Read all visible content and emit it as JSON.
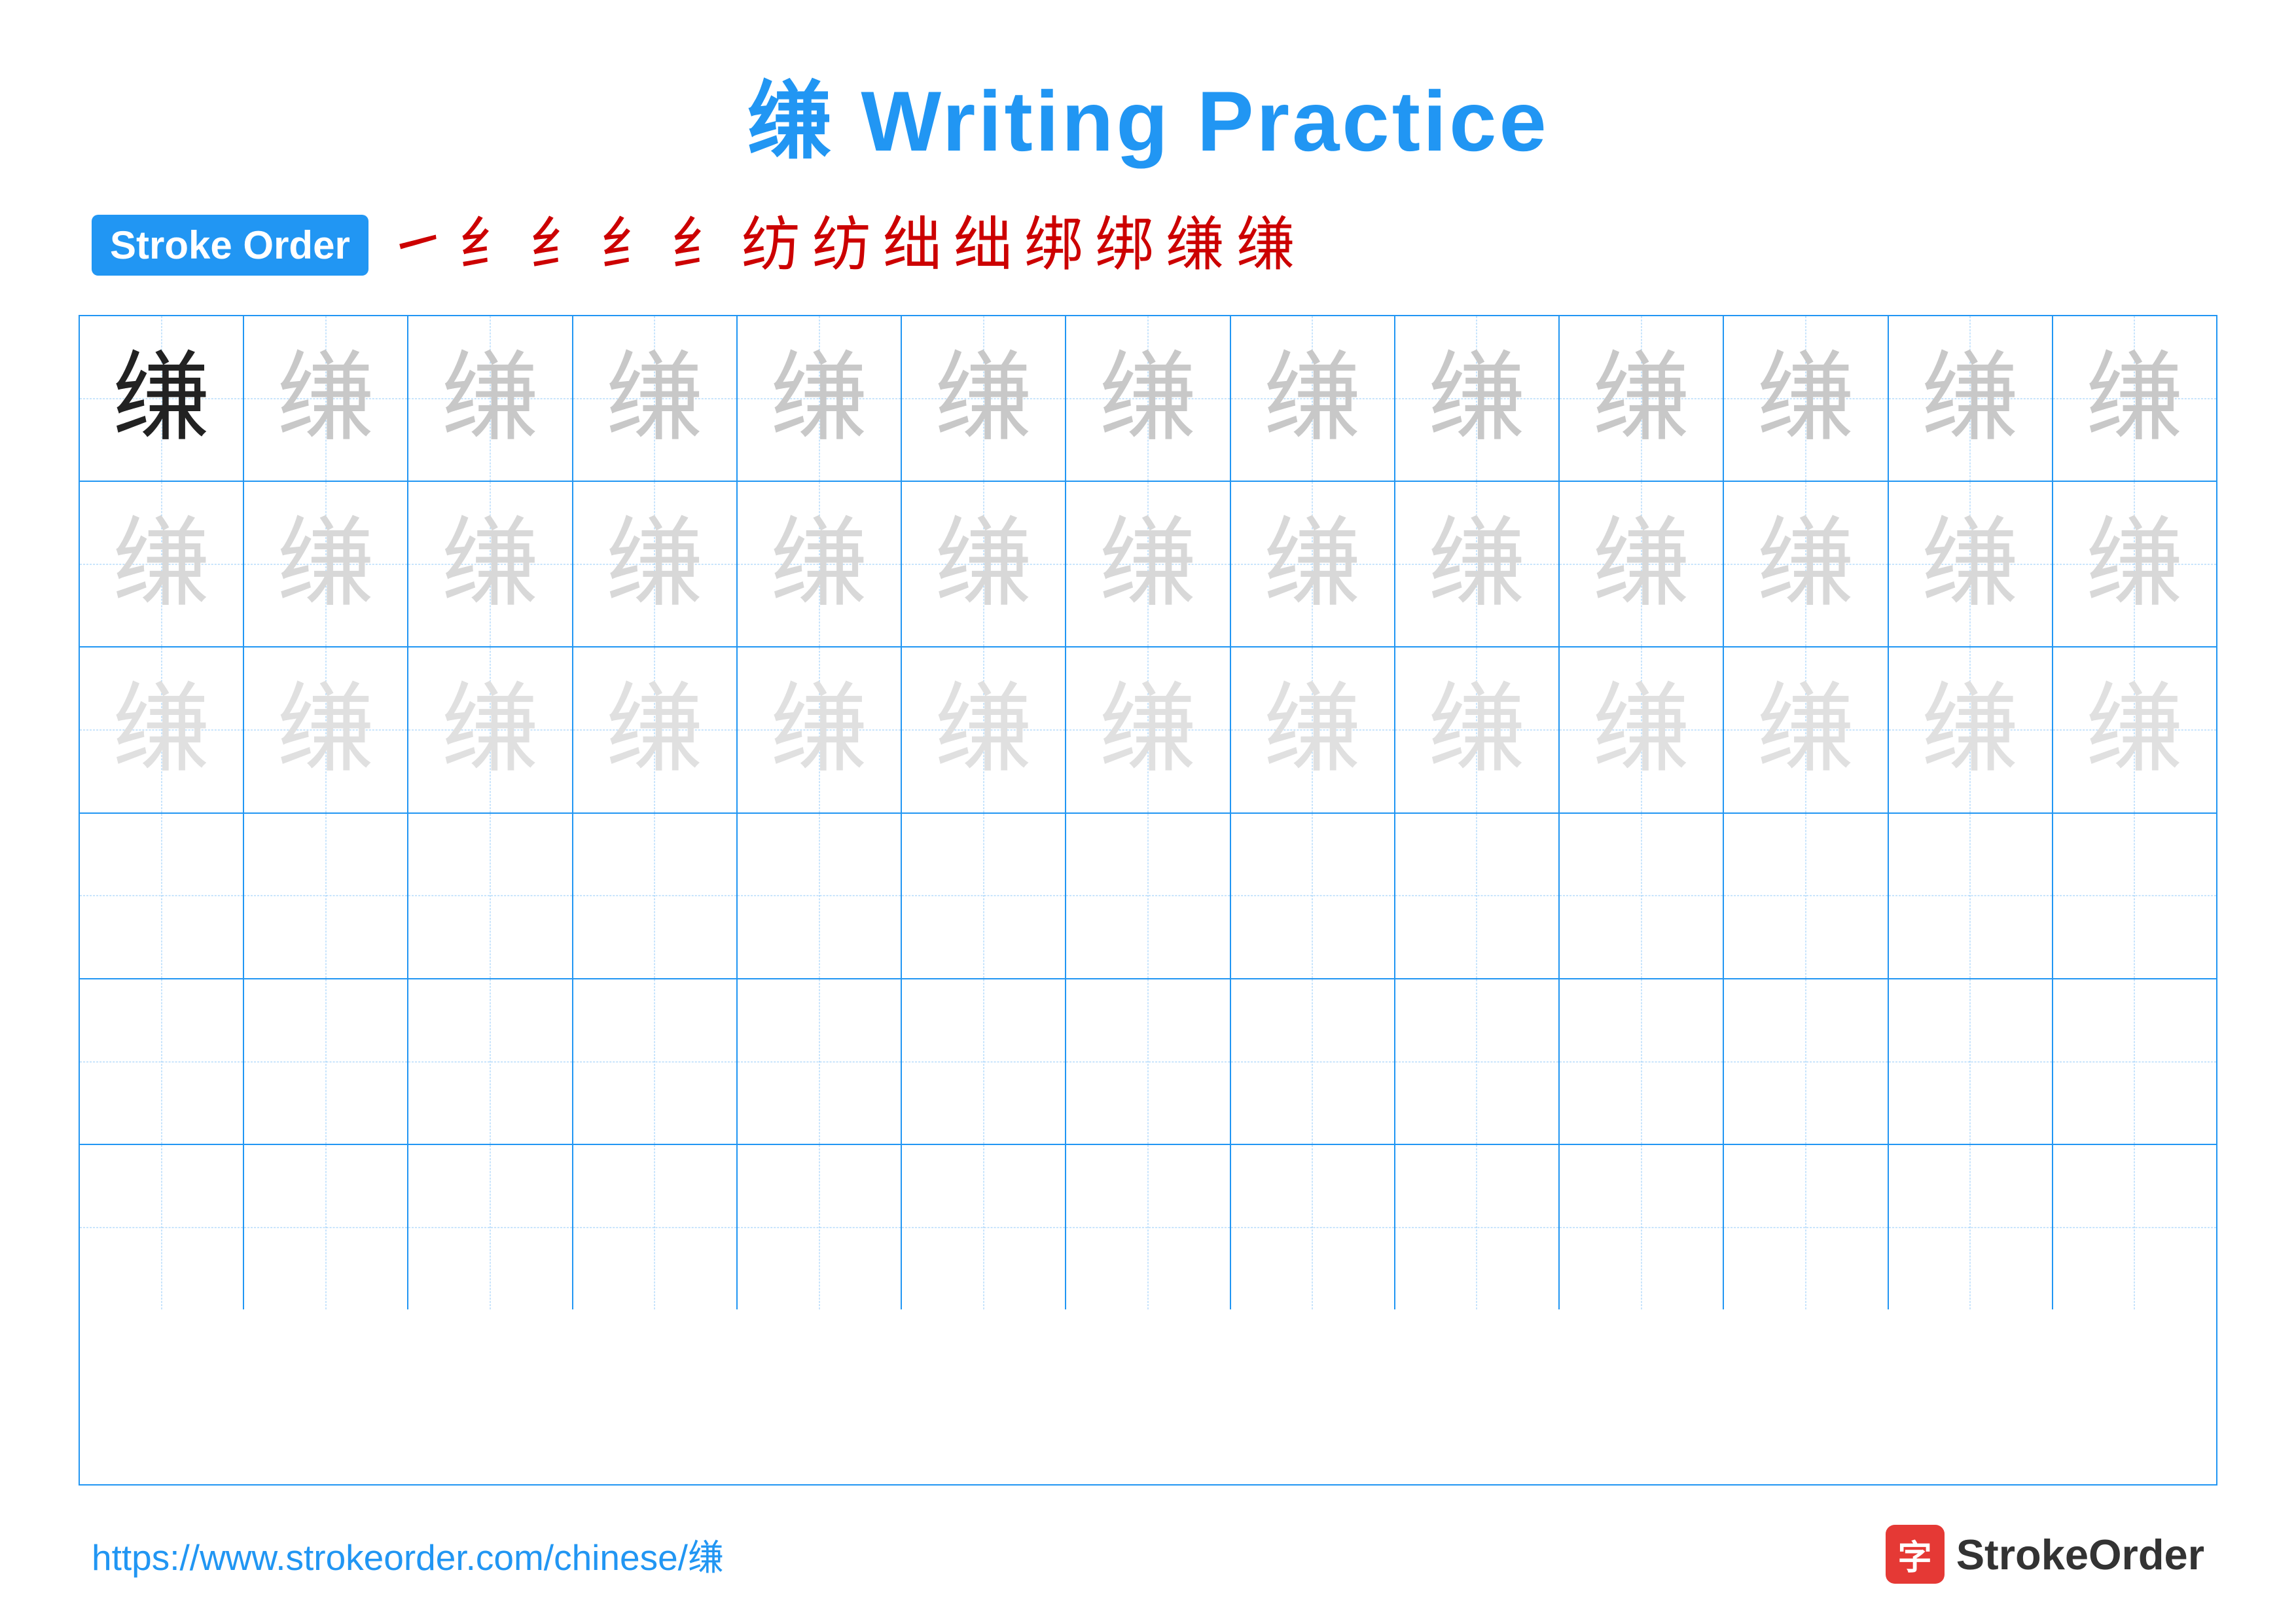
{
  "title": {
    "char": "缣",
    "label": "Writing Practice",
    "full": "缣 Writing Practice"
  },
  "stroke_order": {
    "badge_label": "Stroke Order",
    "strokes": [
      "㇀",
      "纟",
      "纟",
      "纟",
      "纟",
      "纺",
      "纺",
      "绌",
      "绌",
      "绑",
      "绑",
      "缣",
      "缣"
    ]
  },
  "grid": {
    "rows": 6,
    "cols": 13,
    "character": "缣",
    "row_configs": [
      {
        "style": "dark",
        "count": 1,
        "rest_style": "light1"
      },
      {
        "style": "lighter",
        "count": 13
      },
      {
        "style": "lightest",
        "count": 13
      },
      {
        "style": "empty",
        "count": 13
      },
      {
        "style": "empty",
        "count": 13
      },
      {
        "style": "empty",
        "count": 13
      }
    ]
  },
  "footer": {
    "url": "https://www.strokeorder.com/chinese/缣",
    "logo_char": "字",
    "logo_text": "StrokeOrder"
  }
}
